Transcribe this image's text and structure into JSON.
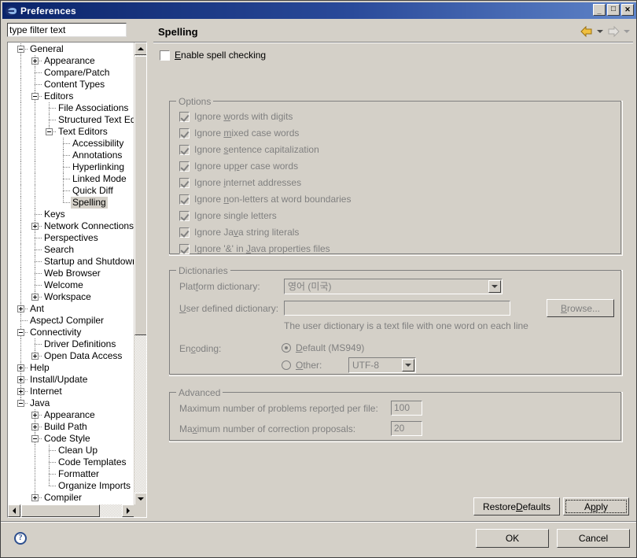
{
  "window": {
    "title": "Preferences",
    "icon": "eclipse-icon",
    "controls": {
      "minimize": "_",
      "maximize": "□",
      "close": "✕"
    }
  },
  "sidebar": {
    "filter": {
      "value": "type filter text",
      "placeholder": "type filter text"
    },
    "tree": [
      {
        "label": "General",
        "depth": 0,
        "toggle": "minus",
        "selected": false
      },
      {
        "label": "Appearance",
        "depth": 1,
        "toggle": "plus",
        "selected": false
      },
      {
        "label": "Compare/Patch",
        "depth": 1,
        "toggle": "none",
        "selected": false
      },
      {
        "label": "Content Types",
        "depth": 1,
        "toggle": "none",
        "selected": false
      },
      {
        "label": "Editors",
        "depth": 1,
        "toggle": "minus",
        "selected": false
      },
      {
        "label": "File Associations",
        "depth": 2,
        "toggle": "none",
        "selected": false
      },
      {
        "label": "Structured Text Editor",
        "depth": 2,
        "toggle": "none",
        "selected": false
      },
      {
        "label": "Text Editors",
        "depth": 2,
        "toggle": "minus",
        "selected": false
      },
      {
        "label": "Accessibility",
        "depth": 3,
        "toggle": "none",
        "selected": false
      },
      {
        "label": "Annotations",
        "depth": 3,
        "toggle": "none",
        "selected": false
      },
      {
        "label": "Hyperlinking",
        "depth": 3,
        "toggle": "none",
        "selected": false
      },
      {
        "label": "Linked Mode",
        "depth": 3,
        "toggle": "none",
        "selected": false
      },
      {
        "label": "Quick Diff",
        "depth": 3,
        "toggle": "none",
        "selected": false
      },
      {
        "label": "Spelling",
        "depth": 3,
        "toggle": "none",
        "selected": true
      },
      {
        "label": "Keys",
        "depth": 1,
        "toggle": "none",
        "selected": false
      },
      {
        "label": "Network Connections",
        "depth": 1,
        "toggle": "plus",
        "selected": false
      },
      {
        "label": "Perspectives",
        "depth": 1,
        "toggle": "none",
        "selected": false
      },
      {
        "label": "Search",
        "depth": 1,
        "toggle": "none",
        "selected": false
      },
      {
        "label": "Startup and Shutdown",
        "depth": 1,
        "toggle": "none",
        "selected": false
      },
      {
        "label": "Web Browser",
        "depth": 1,
        "toggle": "none",
        "selected": false
      },
      {
        "label": "Welcome",
        "depth": 1,
        "toggle": "none",
        "selected": false
      },
      {
        "label": "Workspace",
        "depth": 1,
        "toggle": "plus",
        "selected": false
      },
      {
        "label": "Ant",
        "depth": 0,
        "toggle": "plus",
        "selected": false
      },
      {
        "label": "AspectJ Compiler",
        "depth": 0,
        "toggle": "none",
        "selected": false
      },
      {
        "label": "Connectivity",
        "depth": 0,
        "toggle": "minus",
        "selected": false
      },
      {
        "label": "Driver Definitions",
        "depth": 1,
        "toggle": "none",
        "selected": false
      },
      {
        "label": "Open Data Access",
        "depth": 1,
        "toggle": "plus",
        "selected": false
      },
      {
        "label": "Help",
        "depth": 0,
        "toggle": "plus",
        "selected": false
      },
      {
        "label": "Install/Update",
        "depth": 0,
        "toggle": "plus",
        "selected": false
      },
      {
        "label": "Internet",
        "depth": 0,
        "toggle": "plus",
        "selected": false
      },
      {
        "label": "Java",
        "depth": 0,
        "toggle": "minus",
        "selected": false
      },
      {
        "label": "Appearance",
        "depth": 1,
        "toggle": "plus",
        "selected": false
      },
      {
        "label": "Build Path",
        "depth": 1,
        "toggle": "plus",
        "selected": false
      },
      {
        "label": "Code Style",
        "depth": 1,
        "toggle": "minus",
        "selected": false
      },
      {
        "label": "Clean Up",
        "depth": 2,
        "toggle": "none",
        "selected": false
      },
      {
        "label": "Code Templates",
        "depth": 2,
        "toggle": "none",
        "selected": false
      },
      {
        "label": "Formatter",
        "depth": 2,
        "toggle": "none",
        "selected": false
      },
      {
        "label": "Organize Imports",
        "depth": 2,
        "toggle": "none",
        "selected": false
      },
      {
        "label": "Compiler",
        "depth": 1,
        "toggle": "plus",
        "selected": false
      }
    ]
  },
  "page": {
    "title": "Spelling",
    "nav": {
      "back": "back-arrow",
      "back_menu": "back-dropdown",
      "forward": "forward-arrow",
      "forward_menu": "forward-dropdown"
    },
    "enable": {
      "label": "Enable spell checking",
      "label_pre": "E",
      "label_post": "nable spell checking",
      "checked": false
    }
  },
  "options": {
    "title": "Options",
    "items": [
      {
        "pre": "Ignore ",
        "mn": "w",
        "post": "ords with digits",
        "checked": true,
        "disabled": true
      },
      {
        "pre": "Ignore ",
        "mn": "m",
        "post": "ixed case words",
        "checked": true,
        "disabled": true
      },
      {
        "pre": "Ignore ",
        "mn": "s",
        "post": "entence capitalization",
        "checked": true,
        "disabled": true
      },
      {
        "pre": "Ignore up",
        "mn": "p",
        "post": "er case words",
        "checked": true,
        "disabled": true
      },
      {
        "pre": "Ignore ",
        "mn": "i",
        "post": "nternet addresses",
        "checked": true,
        "disabled": true
      },
      {
        "pre": "Ignore ",
        "mn": "n",
        "post": "on-letters at word boundaries",
        "checked": true,
        "disabled": true
      },
      {
        "pre": "I",
        "mn": "g",
        "post": "nore single letters",
        "checked": true,
        "disabled": true
      },
      {
        "pre": "Ignore Ja",
        "mn": "v",
        "post": "a string literals",
        "checked": true,
        "disabled": true
      },
      {
        "pre": "Ignore '&' in ",
        "mn": "J",
        "post": "ava properties files",
        "checked": true,
        "disabled": true
      }
    ]
  },
  "dictionaries": {
    "title": "Dictionaries",
    "platform_label_pre": "Platform dictionary:",
    "platform_label_mn": "f",
    "platform_value": "영어 (미국)",
    "user_label_mn": "U",
    "user_label_post": "ser defined dictionary:",
    "user_value": "",
    "browse_label": "Browse...",
    "browse_mn": "B",
    "hint": "The user dictionary is a text file with one word on each line",
    "encoding_label_pre": "En",
    "encoding_label_mn": "c",
    "encoding_label_post": "oding:",
    "default_label_mn": "D",
    "default_label_post": "efault (MS949)",
    "default_selected": true,
    "other_label_mn": "O",
    "other_label_post": "ther:",
    "other_selected": false,
    "other_value": "UTF-8"
  },
  "advanced": {
    "title": "Advanced",
    "max_problems_pre": "Maximum number of problems repor",
    "max_problems_mn": "t",
    "max_problems_post": "ed per file:",
    "max_problems_value": "100",
    "max_proposals_pre": "Ma",
    "max_proposals_mn": "x",
    "max_proposals_post": "imum number of correction proposals:",
    "max_proposals_value": "20"
  },
  "buttons": {
    "restore_defaults_pre": "Restore ",
    "restore_defaults_mn": "D",
    "restore_defaults_post": "efaults",
    "apply_pre": "A",
    "apply_mn": "p",
    "apply_post": "ply",
    "ok": "OK",
    "cancel": "Cancel"
  },
  "help": {
    "glyph": "?"
  }
}
